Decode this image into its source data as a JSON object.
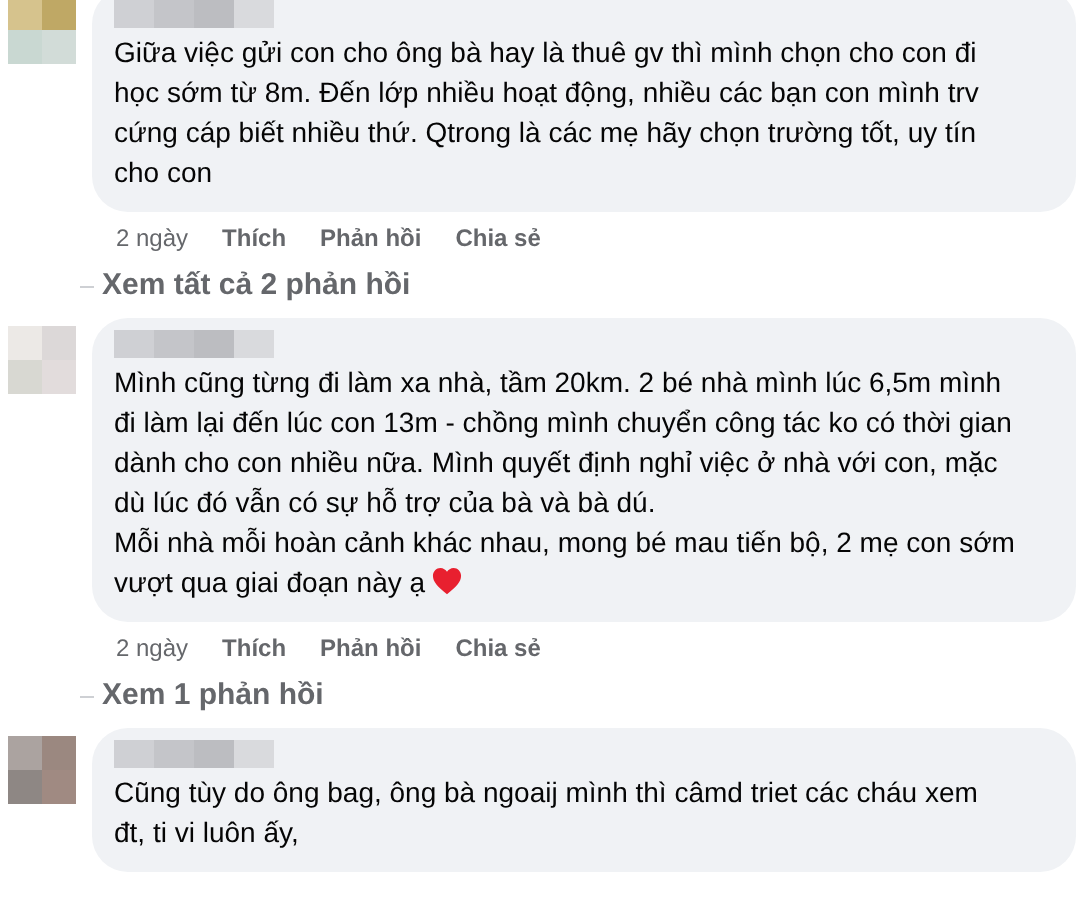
{
  "comments": [
    {
      "text": "Giữa việc gửi con cho ông bà hay là thuê gv thì mình chọn cho con đi học sớm từ 8m. Đến lớp nhiều hoạt động, nhiều các bạn con mình trv cứng cáp biết nhiều thứ. Qtrong là các mẹ hãy chọn trường tốt, uy tín cho con",
      "time": "2 ngày",
      "actions": [
        "Thích",
        "Phản hồi",
        "Chia sẻ"
      ],
      "replies_link": "Xem tất cả 2 phản hồi"
    },
    {
      "text": "Mình cũng từng đi làm xa nhà, tầm 20km. 2 bé nhà mình lúc 6,5m mình đi làm lại đến lúc con 13m - chồng mình chuyển công tác ko có thời gian dành cho con nhiều nữa. Mình quyết định nghỉ việc ở nhà với con, mặc dù lúc đó vẫn có sự hỗ trợ của bà và bà dú.\nMỗi nhà mỗi hoàn cảnh khác nhau, mong bé mau tiến bộ, 2 mẹ con sớm vượt qua giai đoạn này ạ",
      "heart": true,
      "time": "2 ngày",
      "actions": [
        "Thích",
        "Phản hồi",
        "Chia sẻ"
      ],
      "replies_link": "Xem 1 phản hồi"
    },
    {
      "text": "Cũng tùy do ông bag, ông bà ngoaij mình thì câmd triet các cháu xem đt, ti vi luôn ấy,"
    }
  ]
}
